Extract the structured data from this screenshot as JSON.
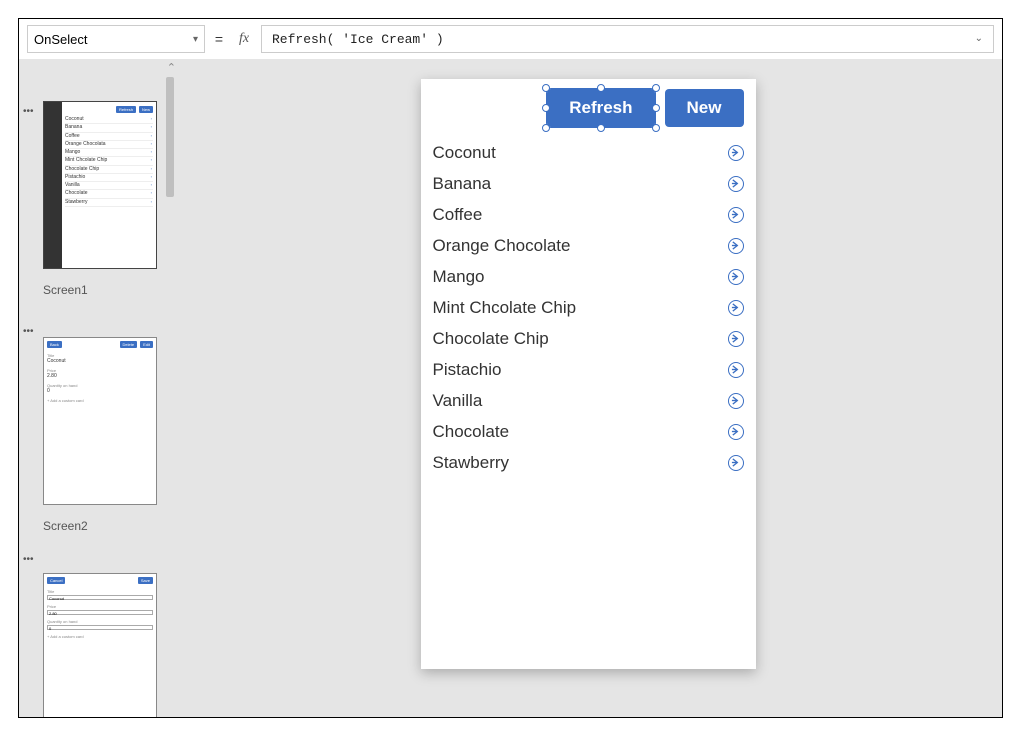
{
  "formula_bar": {
    "property": "OnSelect",
    "formula": "Refresh( 'Ice Cream' )"
  },
  "thumbnails": {
    "screen1": {
      "label": "Screen1",
      "buttons": {
        "refresh": "Refresh",
        "new_": "New"
      },
      "items": [
        "Coconut",
        "Banana",
        "Coffee",
        "Orange Chocolata",
        "Mango",
        "Mint Chcolate Chip",
        "Chocolate Chip",
        "Pistachio",
        "Vanilla",
        "Chocolate",
        "Stawberry"
      ]
    },
    "screen2": {
      "label": "Screen2",
      "buttons": {
        "back": "Back",
        "delete": "Delete",
        "edit": "Edit"
      },
      "fields": {
        "title_label": "Title",
        "title_value": "Coconut",
        "price_label": "Price",
        "price_value": "2.80",
        "qty_label": "Quantity on hand",
        "qty_value": "0"
      },
      "add_card": "+  Add a custom card"
    },
    "screen3": {
      "buttons": {
        "cancel": "Cancel",
        "save": "Save"
      },
      "fields": {
        "title_label": "Title",
        "title_value": "Coconut",
        "price_label": "Price",
        "price_value": "2.80",
        "qty_label": "Quantity on hand",
        "qty_value": "0"
      },
      "add_card": "+  Add a custom card"
    }
  },
  "canvas": {
    "refresh_label": "Refresh",
    "new_label": "New",
    "items": [
      "Coconut",
      "Banana",
      "Coffee",
      "Orange Chocolate",
      "Mango",
      "Mint Chcolate Chip",
      "Chocolate Chip",
      "Pistachio",
      "Vanilla",
      "Chocolate",
      "Stawberry"
    ]
  }
}
